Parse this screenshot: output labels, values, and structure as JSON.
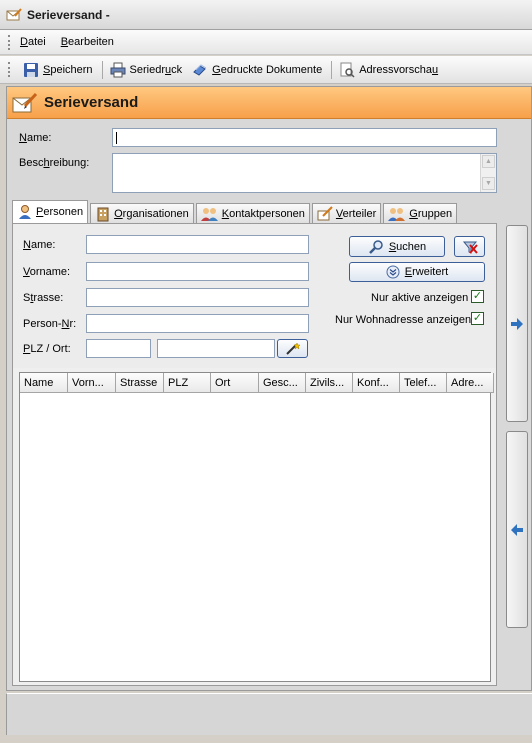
{
  "window": {
    "title": "Serieversand -"
  },
  "menu": {
    "items": [
      "Datei",
      "Bearbeiten"
    ]
  },
  "toolbar": {
    "save": "Speichern",
    "serial_print": "Seriedruck",
    "printed_docs": "Gedruckte Dokumente",
    "address_preview": "Adressvorschau"
  },
  "header": {
    "title": "Serieversand"
  },
  "form": {
    "name_label": "Name:",
    "name_value": "",
    "description_label": "Beschreibung:",
    "description_value": ""
  },
  "tabs": [
    {
      "label": "Personen",
      "icon": "person-icon",
      "active": true
    },
    {
      "label": "Organisationen",
      "icon": "building-icon"
    },
    {
      "label": "Kontaktpersonen",
      "icon": "contacts-icon"
    },
    {
      "label": "Verteiler",
      "icon": "distribution-icon"
    },
    {
      "label": "Gruppen",
      "icon": "group-icon"
    }
  ],
  "filters": {
    "name_label": "Name:",
    "vorname_label": "Vorname:",
    "strasse_label": "Strasse:",
    "person_nr_label": "Person-Nr:",
    "plz_ort_label": "PLZ / Ort:",
    "search_button": "Suchen",
    "extended_button": "Erweitert",
    "active_only_label": "Nur aktive anzeigen",
    "active_only_checked": true,
    "home_address_label": "Nur Wohnadresse anzeigen",
    "home_address_checked": true
  },
  "grid": {
    "columns": [
      "Name",
      "Vorn...",
      "Strasse",
      "PLZ",
      "Ort",
      "Gesc...",
      "Zivils...",
      "Konf...",
      "Telef...",
      "Adre..."
    ],
    "rows": []
  },
  "colors": {
    "header_orange": "#f7a04a",
    "accent_blue": "#3c5f9a",
    "check_green": "#1a7a1a",
    "arrow_blue": "#2f73c0"
  }
}
